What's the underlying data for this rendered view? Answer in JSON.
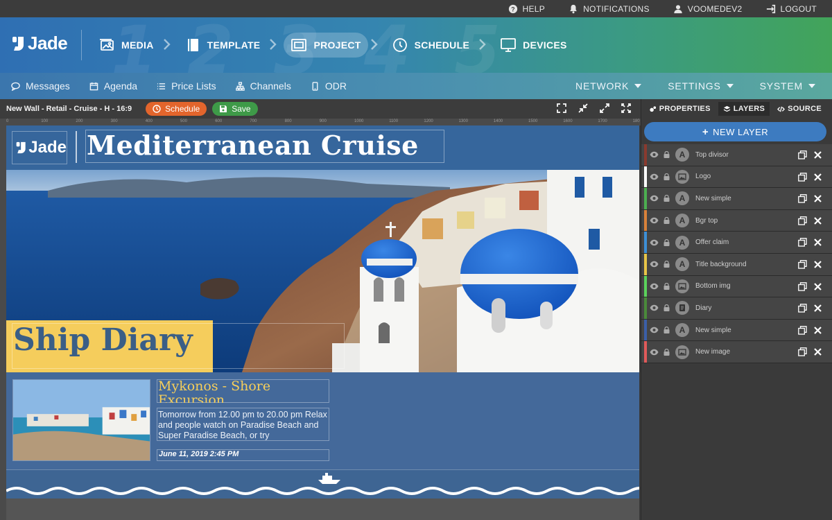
{
  "topbar": {
    "help": "HELP",
    "notifications": "NOTIFICATIONS",
    "user": "VOOMEDEV2",
    "logout": "LOGOUT"
  },
  "header": {
    "logo": "Jade",
    "steps": [
      {
        "label": "MEDIA",
        "icon": "image-icon"
      },
      {
        "label": "TEMPLATE",
        "icon": "book-icon"
      },
      {
        "label": "PROJECT",
        "icon": "project-icon",
        "active": true
      },
      {
        "label": "SCHEDULE",
        "icon": "clock-icon"
      },
      {
        "label": "DEVICES",
        "icon": "monitor-icon"
      }
    ],
    "step_numbers": [
      "1",
      "2",
      "3",
      "4",
      "5"
    ]
  },
  "subnav": {
    "left": [
      {
        "label": "Messages",
        "icon": "chat-icon"
      },
      {
        "label": "Agenda",
        "icon": "calendar-icon"
      },
      {
        "label": "Price Lists",
        "icon": "list-icon"
      },
      {
        "label": "Channels",
        "icon": "sitemap-icon"
      },
      {
        "label": "ODR",
        "icon": "mobile-icon"
      }
    ],
    "right": [
      "NETWORK",
      "SETTINGS",
      "SYSTEM"
    ]
  },
  "toolbar": {
    "doc_name": "New Wall - Retail - Cruise - H - 16:9",
    "schedule_label": "Schedule",
    "save_label": "Save"
  },
  "panel": {
    "tabs": [
      "PROPERTIES",
      "LAYERS",
      "SOURCE"
    ],
    "active_tab": "LAYERS",
    "new_layer": "NEW LAYER",
    "layers": [
      {
        "name": "Top divisor",
        "type": "text",
        "color": "#8a3a2e"
      },
      {
        "name": "Logo",
        "type": "image",
        "color": "#ffffff"
      },
      {
        "name": "New simple",
        "type": "text",
        "color": "#4caf50"
      },
      {
        "name": "Bgr top",
        "type": "text",
        "color": "#d9823a"
      },
      {
        "name": "Offer claim",
        "type": "text",
        "color": "#3d8fd6"
      },
      {
        "name": "Title background",
        "type": "text",
        "color": "#e8c547"
      },
      {
        "name": "Bottom img",
        "type": "image",
        "color": "#5bd35b"
      },
      {
        "name": "Diary",
        "type": "doc",
        "color": "#4a8a3a"
      },
      {
        "name": "New simple",
        "type": "text",
        "color": "#3b5fa8"
      },
      {
        "name": "New image",
        "type": "image",
        "color": "#e05a5a"
      }
    ]
  },
  "ruler": {
    "ticks": [
      "0",
      "100",
      "200",
      "300",
      "400",
      "500",
      "600",
      "700",
      "800",
      "900",
      "1000",
      "1100",
      "1200",
      "1300",
      "1400",
      "1500",
      "1600",
      "1700",
      "180"
    ]
  },
  "canvas": {
    "logo": "Jade",
    "title": "Mediterranean Cruise",
    "offer_claim": "Ship Diary",
    "diary_heading": "Mykonos - Shore Excursion",
    "diary_body": "Tomorrow from 12.00 pm to 20.00 pm Relax and people watch on Paradise Beach and Super Paradise Beach, or try",
    "diary_date": "June 11, 2019 2:45 PM"
  },
  "colors": {
    "schedule_btn": "#e3652c",
    "save_btn": "#3e9a48",
    "new_layer_btn": "#3d7bc0",
    "claim_bg": "#f5cd5c",
    "diary_heading": "#f7cf5a"
  }
}
